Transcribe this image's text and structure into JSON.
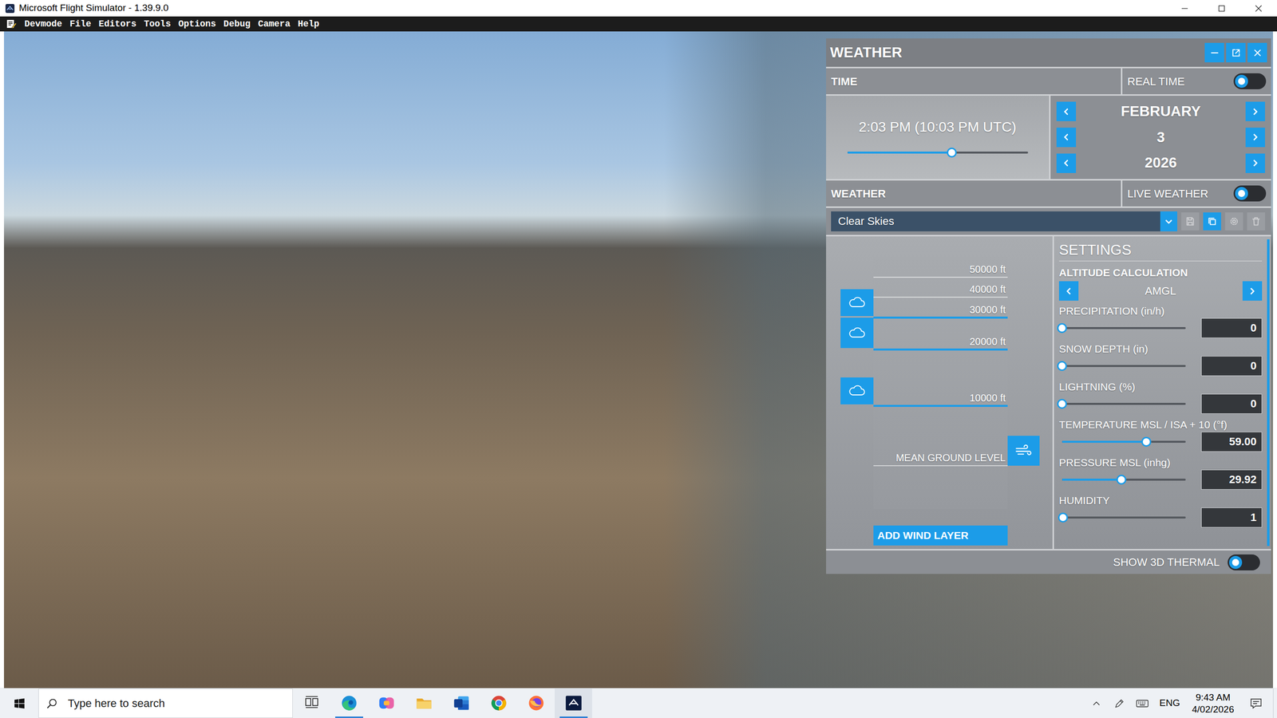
{
  "window": {
    "title": "Microsoft Flight Simulator - 1.39.9.0"
  },
  "menu": [
    "Devmode",
    "File",
    "Editors",
    "Tools",
    "Options",
    "Debug",
    "Camera",
    "Help"
  ],
  "weather_panel": {
    "title": "WEATHER",
    "time": {
      "label": "TIME",
      "real_time": {
        "label": "REAL TIME",
        "on": false
      },
      "clock": "2:03 PM (10:03 PM UTC)",
      "level": 0.58,
      "date": [
        {
          "value": "FEBRUARY"
        },
        {
          "value": "3"
        },
        {
          "value": "2026"
        }
      ]
    },
    "weather": {
      "label": "WEATHER",
      "live_weather": {
        "label": "LIVE WEATHER",
        "on": false
      },
      "preset": "Clear Skies",
      "preset_actions": [
        {
          "kind": "save",
          "disabled": true
        },
        {
          "kind": "copy",
          "disabled": false
        },
        {
          "kind": "settings",
          "disabled": true
        },
        {
          "kind": "delete",
          "disabled": true
        }
      ]
    },
    "altitude_graph": {
      "ticks": [
        {
          "label": "50000 ft",
          "ft": 50000
        },
        {
          "label": "40000 ft",
          "ft": 40000
        },
        {
          "label": "30000 ft",
          "ft": 30000
        },
        {
          "label": "20000 ft",
          "ft": 20000
        },
        {
          "label": "10000 ft",
          "ft": 10000
        },
        {
          "label": "MEAN GROUND LEVEL",
          "ft": 0
        }
      ],
      "cloud_layers": [
        {
          "base_ft": 30000,
          "top_ft": 44000
        },
        {
          "base_ft": 20000,
          "top_ft": 30000
        },
        {
          "base_ft": 10000,
          "top_ft": 15000
        }
      ],
      "wind_layers": [
        {
          "altitude_ft": 0
        }
      ],
      "add_wind_layer": "ADD WIND LAYER"
    },
    "settings": {
      "title": "SETTINGS",
      "altitude_calculation": {
        "label": "ALTITUDE CALCULATION",
        "value": "AMGL"
      },
      "sliders": [
        {
          "label": "PRECIPITATION (in/h)",
          "value": "0",
          "level": 0
        },
        {
          "label": "SNOW DEPTH (in)",
          "value": "0",
          "level": 0
        },
        {
          "label": "LIGHTNING (%)",
          "value": "0",
          "level": 0
        },
        {
          "label": "TEMPERATURE MSL / ISA + 10 (°f)",
          "value": "59.00",
          "level": 0.68
        },
        {
          "label": "PRESSURE MSL (inhg)",
          "value": "29.92",
          "level": 0.48
        },
        {
          "label": "HUMIDITY",
          "value": "1",
          "level": 0.01
        }
      ]
    },
    "show_3d_thermal": {
      "label": "SHOW 3D THERMAL",
      "on": false
    }
  },
  "taskbar": {
    "search": {
      "placeholder": "Type here to search"
    },
    "apps": [
      {
        "kind": "task-view",
        "running": false,
        "selected": false
      },
      {
        "kind": "edge",
        "running": true,
        "selected": false
      },
      {
        "kind": "copilot",
        "running": false,
        "selected": false
      },
      {
        "kind": "explorer",
        "running": false,
        "selected": false
      },
      {
        "kind": "word",
        "running": false,
        "selected": false
      },
      {
        "kind": "chrome",
        "running": false,
        "selected": false
      },
      {
        "kind": "firefox",
        "running": false,
        "selected": false
      },
      {
        "kind": "flight-simulator",
        "running": true,
        "selected": true
      }
    ],
    "tray": {
      "language": "ENG",
      "time": "9:43 AM",
      "date": "4/02/2026"
    }
  }
}
